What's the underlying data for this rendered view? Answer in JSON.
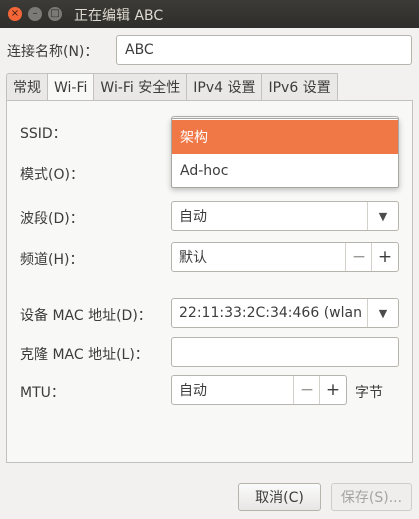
{
  "window": {
    "title": "正在编辑 ABC",
    "close": "×",
    "minimize": "–",
    "maximize": "□"
  },
  "connection_name": {
    "label": "连接名称(N)：",
    "value": "ABC"
  },
  "tabs": [
    {
      "label": "常规"
    },
    {
      "label": "Wi-Fi"
    },
    {
      "label": "Wi-Fi 安全性"
    },
    {
      "label": "IPv4 设置"
    },
    {
      "label": "IPv6 设置"
    }
  ],
  "wifi": {
    "ssid_label": "SSID：",
    "mode_label": "模式(O)：",
    "mode_options": [
      "架构",
      "Ad-hoc"
    ],
    "band_label": "波段(D)：",
    "band_value": "自动",
    "channel_label": "频道(H)：",
    "channel_value": "默认",
    "device_mac_label": "设备 MAC 地址(D)：",
    "device_mac_value": "22:11:33:2C:34:466 (wlan",
    "cloned_mac_label": "克隆 MAC 地址(L)：",
    "cloned_mac_value": "",
    "mtu_label": "MTU：",
    "mtu_value": "自动",
    "mtu_unit": "字节",
    "minus": "−",
    "plus": "+",
    "dropdown_arrow": "▼"
  },
  "buttons": {
    "cancel": "取消(C)",
    "save": "保存(S)..."
  },
  "colors": {
    "accent": "#f07746",
    "titlebar": "#3d3b37",
    "close_button": "#f26637"
  }
}
